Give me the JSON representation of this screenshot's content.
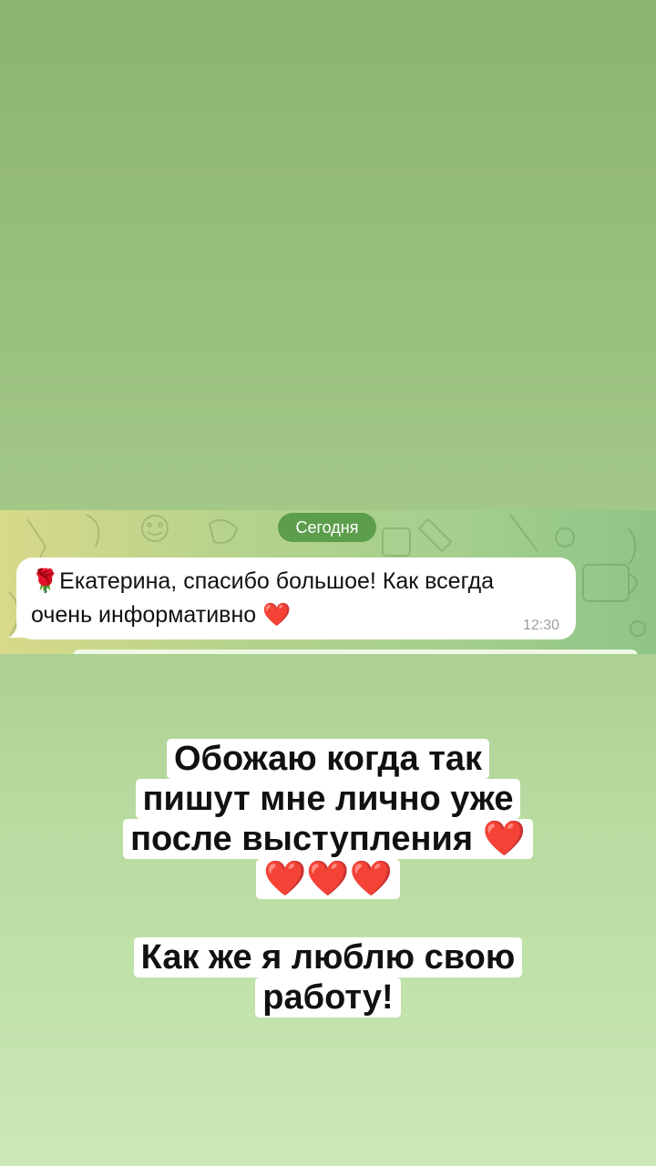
{
  "chat": {
    "date_pill": "Сегодня",
    "message": {
      "emoji_prefix": "🌹",
      "text_line1": "Екатерина, спасибо большое! Как всегда",
      "text_line2": "очень информативно",
      "emoji_suffix": "❤️",
      "time": "12:30"
    }
  },
  "caption1": {
    "lines": [
      "Обожаю когда так",
      "пишут мне лично уже",
      "после выступления",
      "❤️❤️❤️"
    ],
    "line3_heart": "❤️"
  },
  "caption2": {
    "lines": [
      "Как же я люблю свою",
      "работу!"
    ]
  },
  "colors": {
    "background_top": "#8cb46e",
    "background_bottom": "#cbe8b6",
    "date_pill": "#5c9e4c",
    "bubble": "#ffffff",
    "time_text": "#9aa0a6",
    "heart": "#e0202b"
  }
}
